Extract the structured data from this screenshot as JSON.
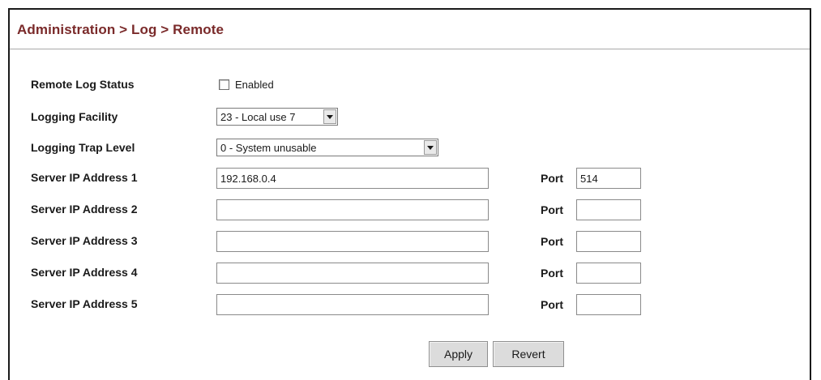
{
  "breadcrumb": "Administration > Log > Remote",
  "remote_log_status": {
    "label": "Remote Log Status",
    "checkbox_label": "Enabled",
    "checked": false
  },
  "logging_facility": {
    "label": "Logging Facility",
    "value": "23 - Local use 7"
  },
  "logging_trap_level": {
    "label": "Logging Trap Level",
    "value": "0 - System unusable"
  },
  "servers": [
    {
      "label": "Server IP Address 1",
      "ip": "192.168.0.4",
      "port_label": "Port",
      "port": "514"
    },
    {
      "label": "Server IP Address 2",
      "ip": "",
      "port_label": "Port",
      "port": ""
    },
    {
      "label": "Server IP Address 3",
      "ip": "",
      "port_label": "Port",
      "port": ""
    },
    {
      "label": "Server IP Address 4",
      "ip": "",
      "port_label": "Port",
      "port": ""
    },
    {
      "label": "Server IP Address 5",
      "ip": "",
      "port_label": "Port",
      "port": ""
    }
  ],
  "buttons": {
    "apply": "Apply",
    "revert": "Revert"
  },
  "colors": {
    "title": "#7a2a2a",
    "border": "#1a1a1a",
    "button": "#dcdcdc"
  }
}
